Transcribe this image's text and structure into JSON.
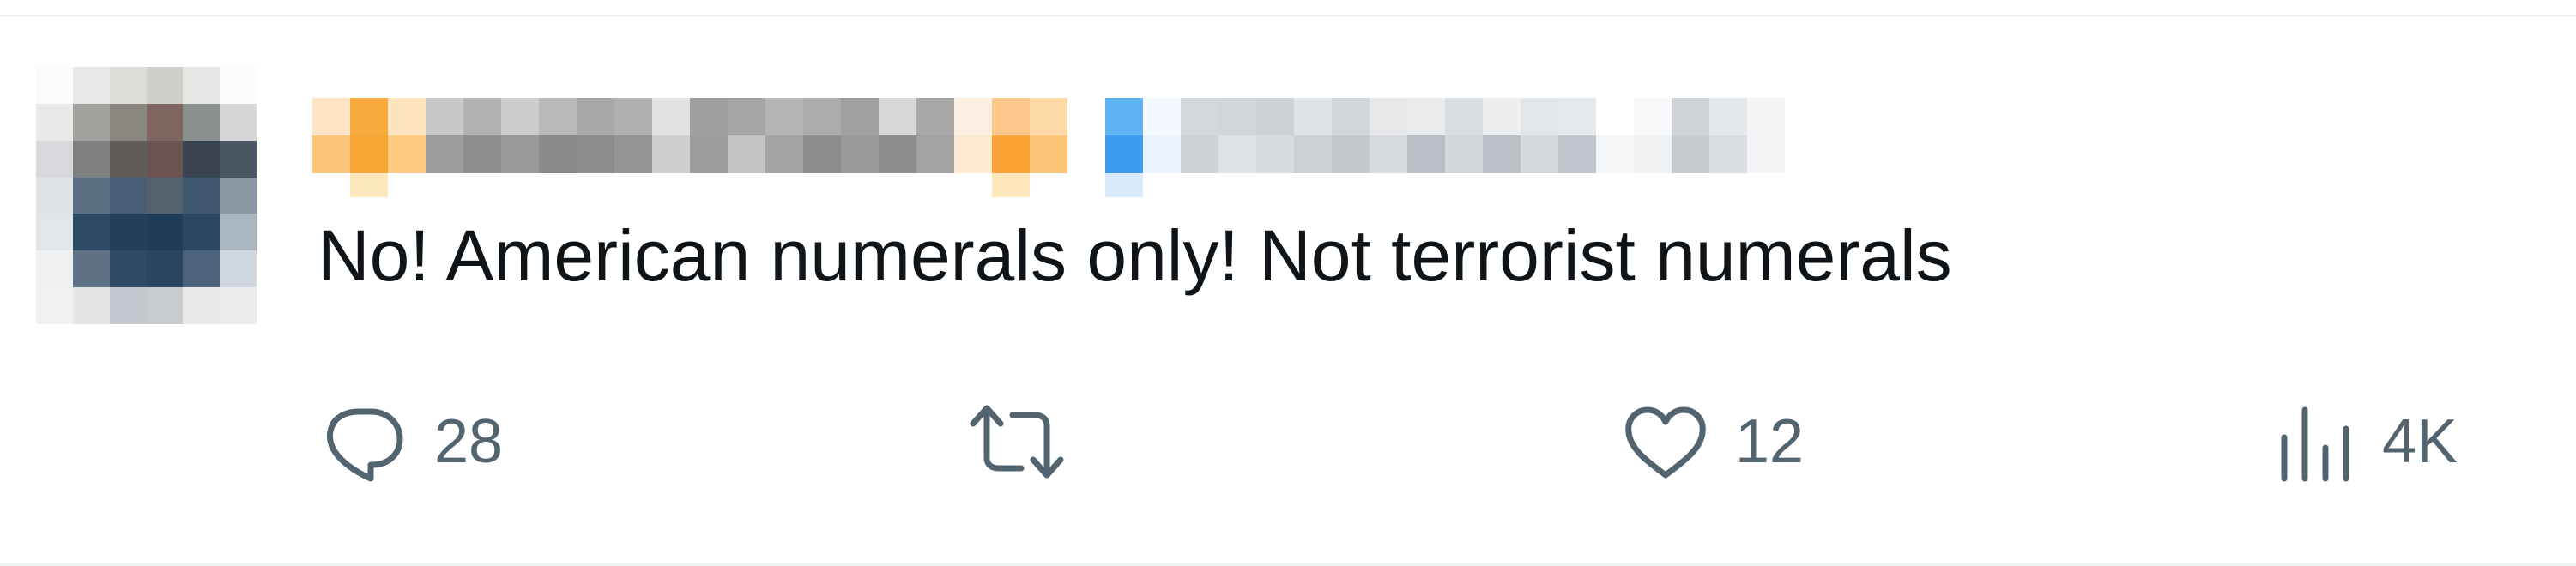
{
  "tweet": {
    "text": "No! American numerals only! Not terrorist numerals"
  },
  "actions": {
    "reply": {
      "icon": "reply-icon",
      "count": "28"
    },
    "retweet": {
      "icon": "retweet-icon",
      "count": ""
    },
    "like": {
      "icon": "heart-icon",
      "count": "12"
    },
    "views": {
      "icon": "views-icon",
      "count": "4K"
    }
  },
  "colors": {
    "text": "#0f1419",
    "muted": "#536471",
    "divider": "#eff3f4"
  }
}
